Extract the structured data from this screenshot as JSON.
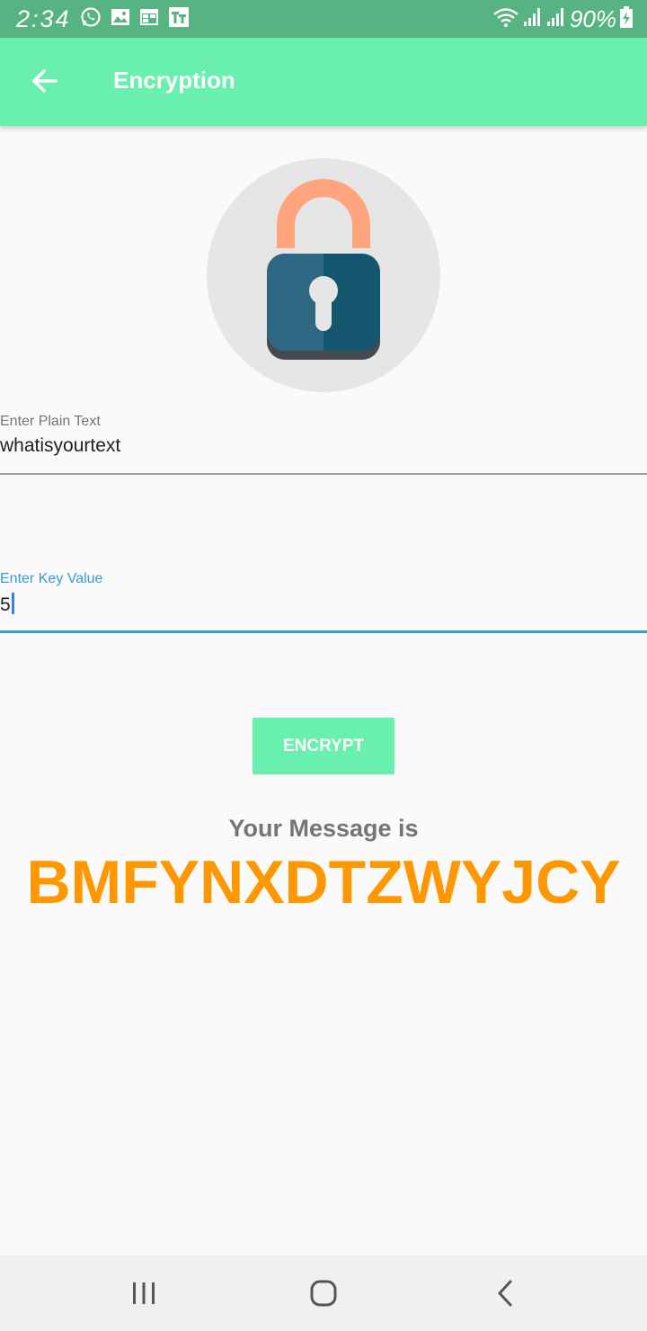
{
  "status_bar": {
    "time": "2:34",
    "battery": "90%",
    "icons": [
      "whatsapp-icon",
      "gallery-icon",
      "calendar-icon",
      "tt-app-icon",
      "wifi-icon",
      "signal-icon",
      "signal-icon",
      "battery-charging-icon"
    ]
  },
  "app_bar": {
    "title": "Encryption",
    "back_icon": "arrow-back-icon",
    "color": "#69f0ae"
  },
  "lock_image": {
    "icon": "padlock-icon"
  },
  "plain_text_field": {
    "label": "Enter Plain Text",
    "value": "whatisyourtext"
  },
  "key_field": {
    "label": "Enter Key Value",
    "value": "5",
    "focused_color": "#3a9ad9"
  },
  "encrypt_button": {
    "label": "ENCRYPT"
  },
  "result": {
    "heading": "Your Message is",
    "value": "BMFYNXDTZWYJCY",
    "color": "#ff9800"
  },
  "nav_bar": {
    "buttons": [
      "recent-apps-icon",
      "home-icon",
      "back-icon"
    ]
  }
}
